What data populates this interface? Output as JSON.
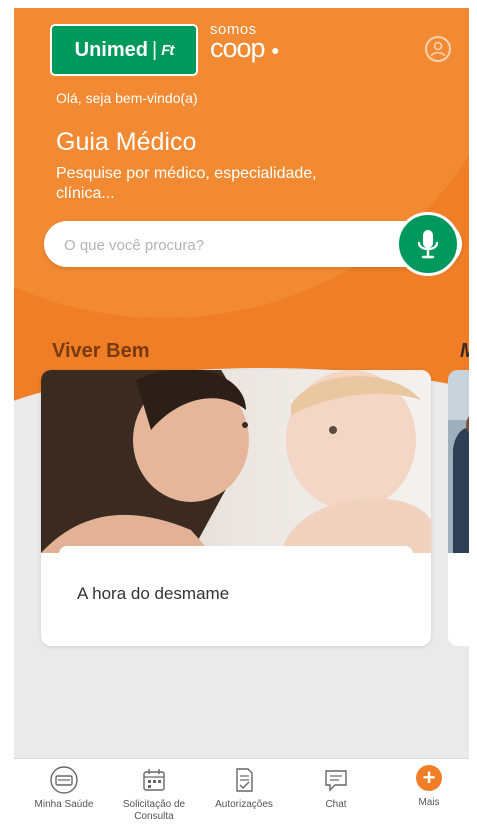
{
  "brand": {
    "logo_text": "Unimed",
    "logo_glyph": "Ft",
    "coop_top": "somos",
    "coop_bottom": "coop"
  },
  "header": {
    "greeting": "Olá, seja bem-vindo(a)",
    "title": "Guia Médico",
    "subtitle": "Pesquise por médico, especialidade, clínica..."
  },
  "search": {
    "placeholder": "O que você procura?",
    "value": ""
  },
  "sections": {
    "viver_bem_title": "Viver Bem",
    "next_section_initial": "M"
  },
  "cards": [
    {
      "title": "A hora do desmame"
    }
  ],
  "bottom_nav": [
    {
      "label": "Minha Saúde",
      "icon": "card-icon"
    },
    {
      "label": "Solicitação de Consulta",
      "icon": "calendar-icon"
    },
    {
      "label": "Autorizações",
      "icon": "document-check-icon"
    },
    {
      "label": "Chat",
      "icon": "chat-icon"
    },
    {
      "label": "Mais",
      "icon": "plus-icon"
    }
  ],
  "colors": {
    "primary_orange": "#f07e26",
    "brand_green": "#00995d",
    "section_title": "#7a3a10"
  }
}
